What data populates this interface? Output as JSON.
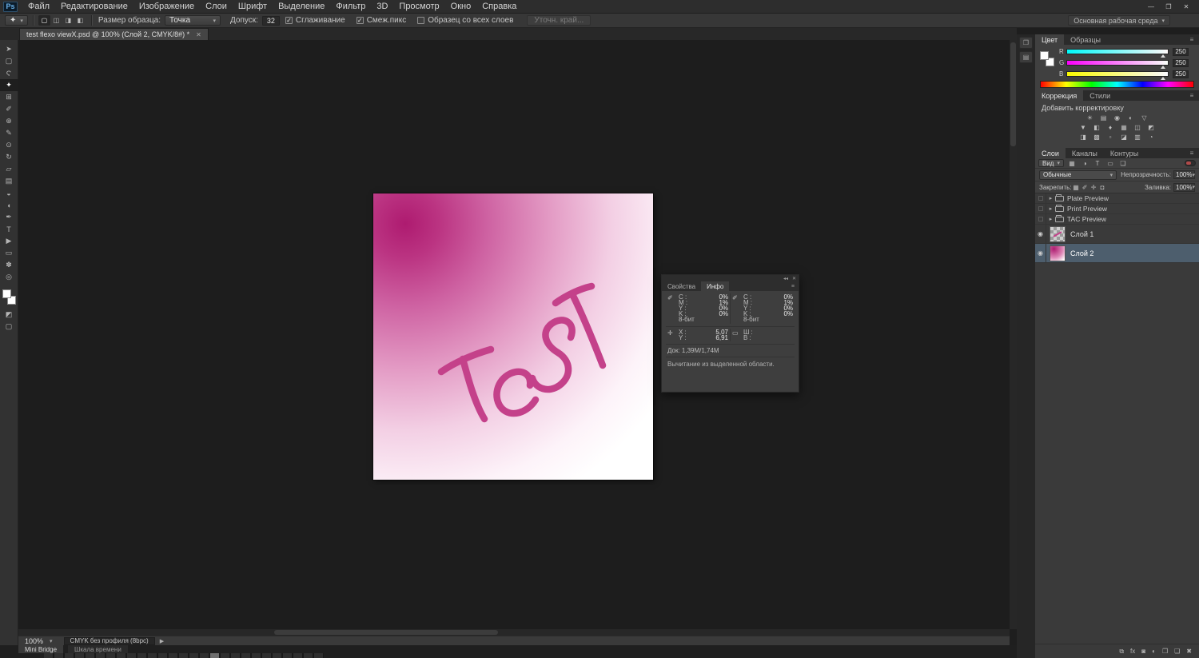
{
  "app": {
    "logo": "Ps",
    "workspace": "Основная рабочая среда",
    "window": {
      "minimize": "—",
      "restore": "❐",
      "close": "✕"
    }
  },
  "menu": {
    "items": [
      "Файл",
      "Редактирование",
      "Изображение",
      "Слои",
      "Шрифт",
      "Выделение",
      "Фильтр",
      "3D",
      "Просмотр",
      "Окно",
      "Справка"
    ]
  },
  "options": {
    "sample_label": "Размер образца:",
    "sample_value": "Точка",
    "tolerance_label": "Допуск:",
    "tolerance_value": "32",
    "antialias_label": "Сглаживание",
    "contiguous_label": "Смеж.пикс",
    "all_layers_label": "Образец со всех слоев",
    "refine_edge_label": "Уточн. край..."
  },
  "doc_tab": {
    "title": "test flexo viewX.psd @ 100% (Слой 2, CMYK/8#) *"
  },
  "toolbar": {
    "tools": [
      {
        "name": "move",
        "glyph": "➤"
      },
      {
        "name": "rectangular-marquee",
        "glyph": "▢"
      },
      {
        "name": "lasso",
        "glyph": "Ϛ"
      },
      {
        "name": "magic-wand",
        "glyph": "✦"
      },
      {
        "name": "crop",
        "glyph": "⊞"
      },
      {
        "name": "eyedropper",
        "glyph": "✐"
      },
      {
        "name": "healing-brush",
        "glyph": "⊕"
      },
      {
        "name": "brush",
        "glyph": "✎"
      },
      {
        "name": "clone-stamp",
        "glyph": "⊙"
      },
      {
        "name": "history-brush",
        "glyph": "↻"
      },
      {
        "name": "eraser",
        "glyph": "▱"
      },
      {
        "name": "gradient",
        "glyph": "▤"
      },
      {
        "name": "blur",
        "glyph": "◒"
      },
      {
        "name": "dodge",
        "glyph": "◖"
      },
      {
        "name": "pen",
        "glyph": "✒"
      },
      {
        "name": "type",
        "glyph": "T"
      },
      {
        "name": "path-selection",
        "glyph": "▶"
      },
      {
        "name": "shape",
        "glyph": "▭"
      },
      {
        "name": "hand",
        "glyph": "✽"
      },
      {
        "name": "zoom",
        "glyph": "◎"
      }
    ]
  },
  "canvas": {
    "artwork_text": "TEST"
  },
  "info_panel": {
    "tabs": [
      "Свойства",
      "Инфо"
    ],
    "left": {
      "c_label": "C :",
      "c": "0%",
      "m_label": "M :",
      "m": "1%",
      "y_label": "Y :",
      "y": "0%",
      "k_label": "K :",
      "k": "0%",
      "depth": "8-бит"
    },
    "right": {
      "c_label": "C :",
      "c": "0%",
      "m_label": "M :",
      "m": "1%",
      "y_label": "Y :",
      "y": "0%",
      "k_label": "K :",
      "k": "0%",
      "depth": "8-бит"
    },
    "pos": {
      "x_label": "X :",
      "x": "5,07",
      "y_label": "Y :",
      "y": "6,91",
      "w_label": "Ш :",
      "h_label": "В :"
    },
    "doc_size": "Док: 1,39M/1,74M",
    "hint": "Вычитание из выделенной области."
  },
  "color_panel": {
    "tabs": [
      "Цвет",
      "Образцы"
    ],
    "sliders": [
      {
        "label": "R",
        "value": "250"
      },
      {
        "label": "G",
        "value": "250"
      },
      {
        "label": "B",
        "value": "250"
      }
    ]
  },
  "adjustments_panel": {
    "tabs": [
      "Коррекция",
      "Стили"
    ],
    "title": "Добавить корректировку",
    "icons": [
      "☀",
      "▤",
      "◉",
      "◐",
      "▽",
      "▼",
      "◧",
      "♦",
      "▦",
      "◫",
      "◩",
      "◨",
      "▩",
      "▫",
      "◪",
      "▥",
      "◔"
    ]
  },
  "layers_panel": {
    "tabs": [
      "Слои",
      "Каналы",
      "Контуры"
    ],
    "filter_label": "Вид",
    "blend_mode": "Обычные",
    "opacity_label": "Непрозрачность:",
    "opacity_value": "100%",
    "lock_label": "Закрепить:",
    "fill_label": "Заливка:",
    "fill_value": "100%",
    "rows": [
      {
        "name": "Plate Preview"
      },
      {
        "name": "Print Preview"
      },
      {
        "name": "TAC Preview"
      },
      {
        "name": "Слой 1"
      },
      {
        "name": "Слой 2"
      }
    ]
  },
  "status_bar": {
    "zoom": "100%",
    "profile": "CMYK без профиля (8bpc)"
  },
  "bottom_bar": {
    "tabs": [
      "Mini Bridge",
      "Шкала времени"
    ]
  },
  "icons": {
    "dropdown": "▾",
    "menu": "≡",
    "close": "✕",
    "eye": "◉",
    "expand": "▸",
    "check": "✓",
    "collapse": "◂◂",
    "play": "▶",
    "eyedropper": "✐",
    "crosshair": "✛",
    "rect": "▭",
    "wand": "✦",
    "sel_new": "▢",
    "sel_add": "◫",
    "sel_sub": "◨",
    "sel_int": "◧",
    "panel_a": "❐",
    "panel_b": "▤",
    "link": "⧉",
    "fx": "fx",
    "mask": "◙",
    "adjust": "◐",
    "group": "❒",
    "new_layer": "❏",
    "trash": "✖",
    "filter_pixel": "▦",
    "filter_adjust": "◑",
    "filter_type": "T",
    "filter_shape": "▭",
    "filter_smart": "❏",
    "lock_transparent": "▦",
    "lock_pixels": "✐",
    "lock_position": "✛",
    "lock_all": "◘"
  }
}
